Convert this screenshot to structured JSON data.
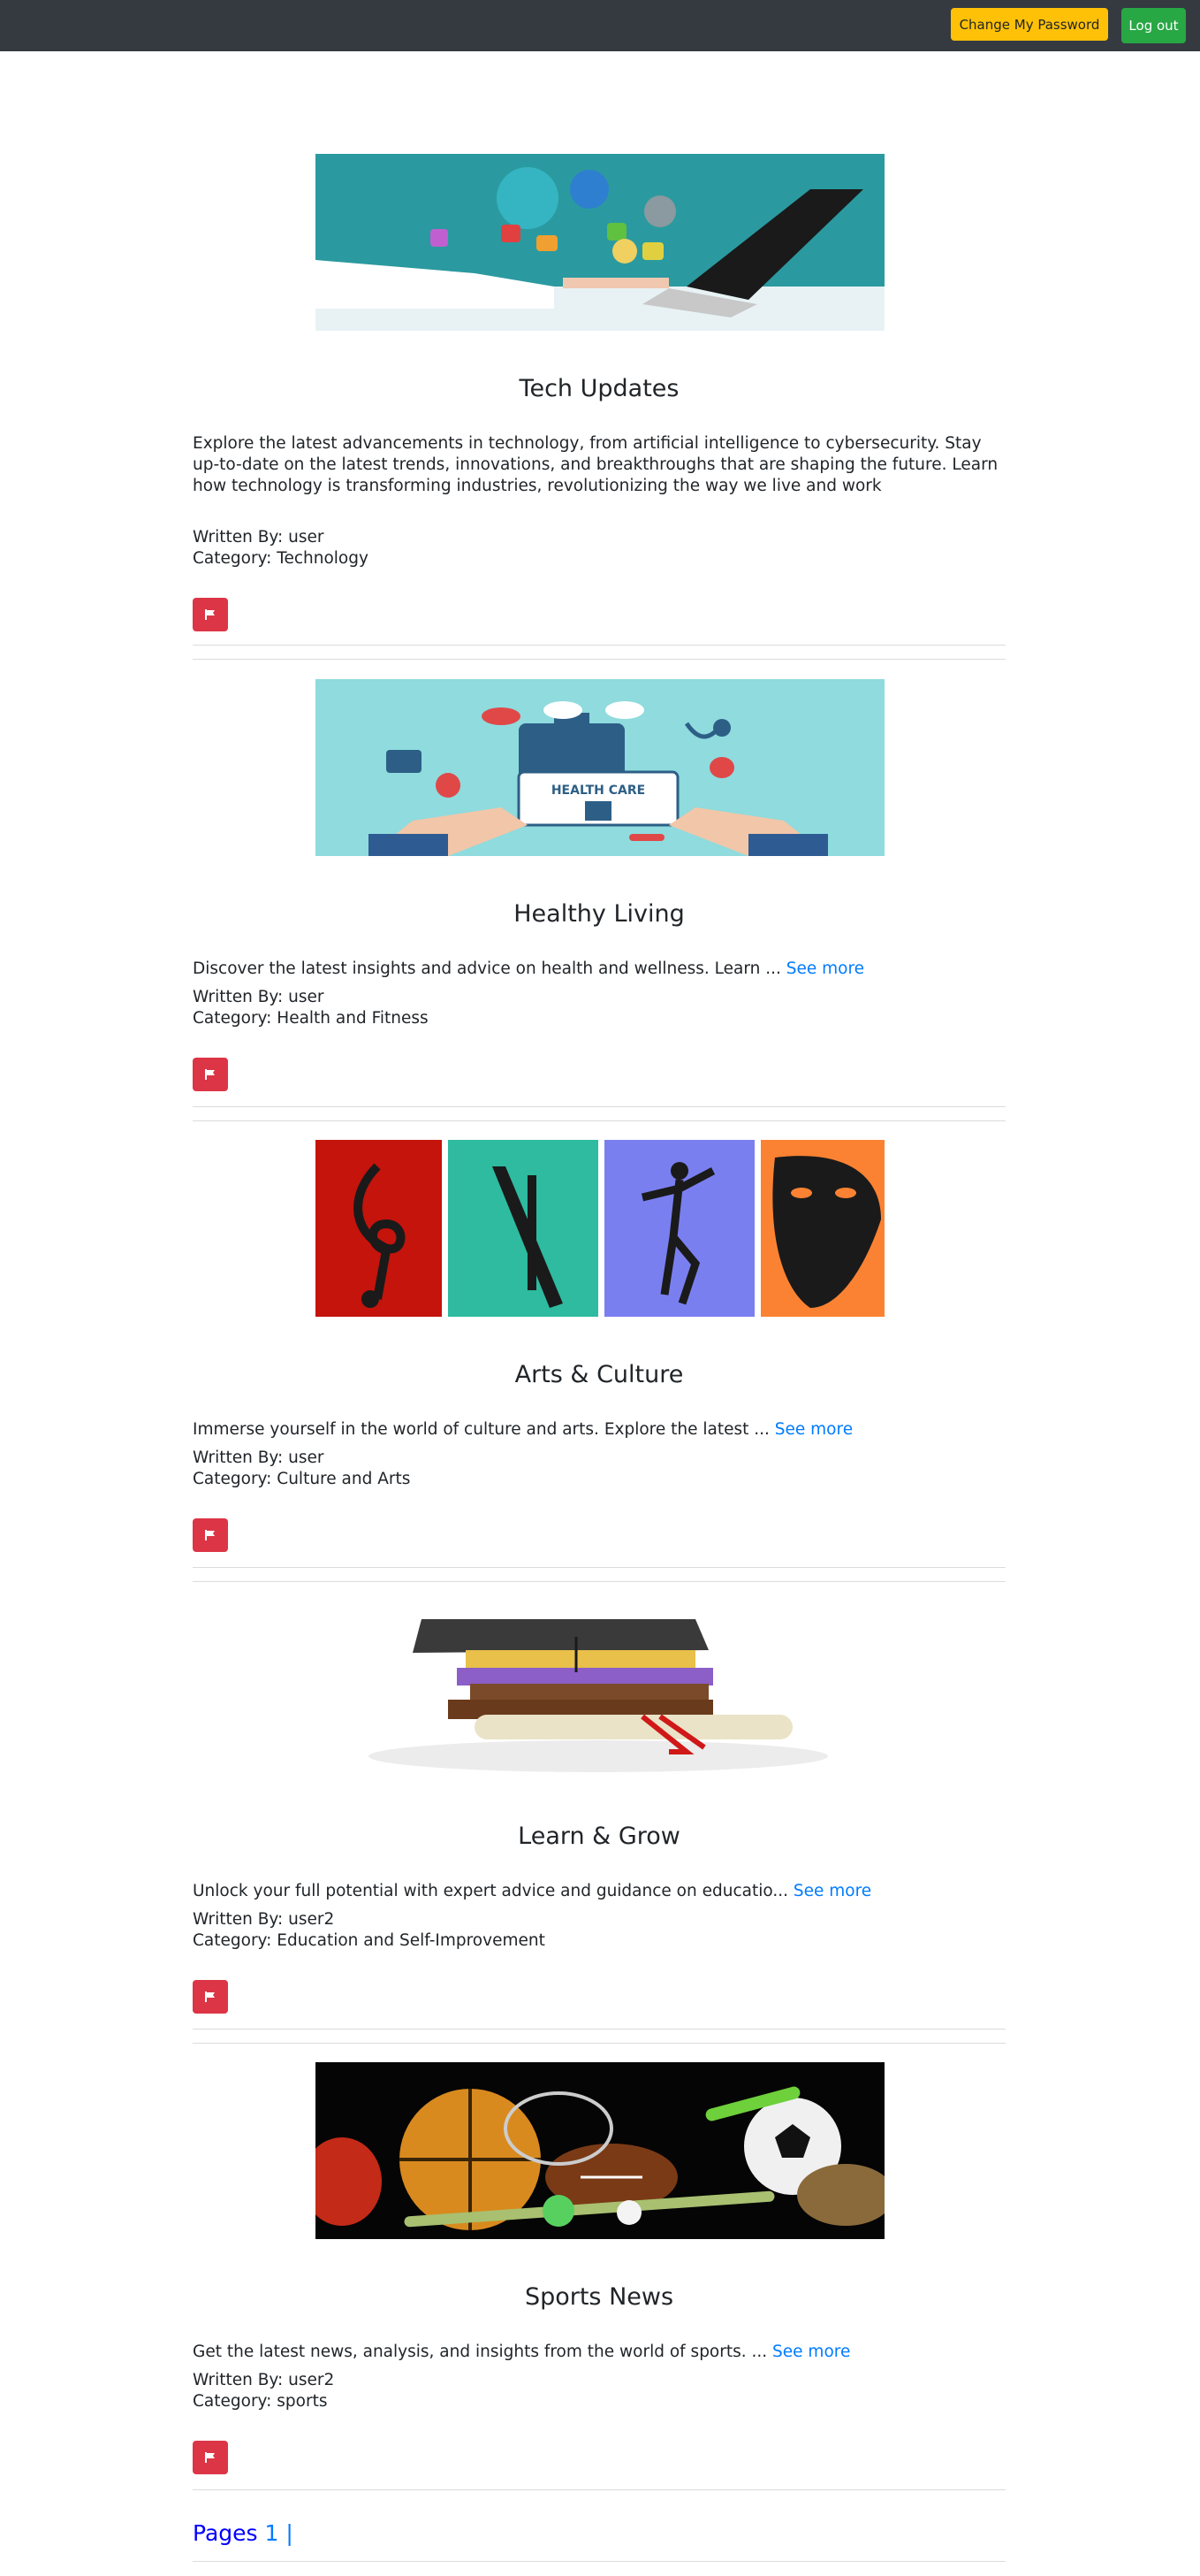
{
  "nav": {
    "change_password": "Change My Password",
    "logout": "Log out"
  },
  "labels": {
    "written_by": "Written By: ",
    "category": "Category: "
  },
  "posts": [
    {
      "title": "Tech Updates",
      "body": "Explore the latest advancements in technology, from artificial intelligence to cybersecurity. Stay up-to-date on the latest trends, innovations, and breakthroughs that are shaping the future. Learn how technology is transforming industries, revolutionizing the way we live and work",
      "see_more": "",
      "author": "user",
      "category": "Technology",
      "image_icon": "tech-image"
    },
    {
      "title": "Healthy Living",
      "body": "Discover the latest insights and advice on health and wellness. Learn ... ",
      "see_more": "See more",
      "author": "user",
      "category": "Health and Fitness",
      "image_icon": "health-care-image",
      "image_text": "HEALTH CARE"
    },
    {
      "title": "Arts & Culture",
      "body": "Immerse yourself in the world of culture and arts. Explore the latest ... ",
      "see_more": "See more",
      "author": "user",
      "category": "Culture and Arts",
      "image_icon": "arts-image"
    },
    {
      "title": "Learn & Grow",
      "body": "Unlock your full potential with expert advice and guidance on educatio... ",
      "see_more": "See more",
      "author": "user2",
      "category": "Education and Self-Improvement",
      "image_icon": "graduation-image"
    },
    {
      "title": "Sports News",
      "body": "Get the latest news, analysis, and insights from the world of sports. ... ",
      "see_more": "See more",
      "author": "user2",
      "category": "sports",
      "image_icon": "sports-image"
    }
  ],
  "pagination": {
    "label": "Pages ",
    "current": "1",
    "separator": " |"
  },
  "colors": {
    "navbar": "#343a40",
    "warning": "#ffc107",
    "success": "#28a745",
    "danger": "#dc3545",
    "link": "#007bff"
  }
}
